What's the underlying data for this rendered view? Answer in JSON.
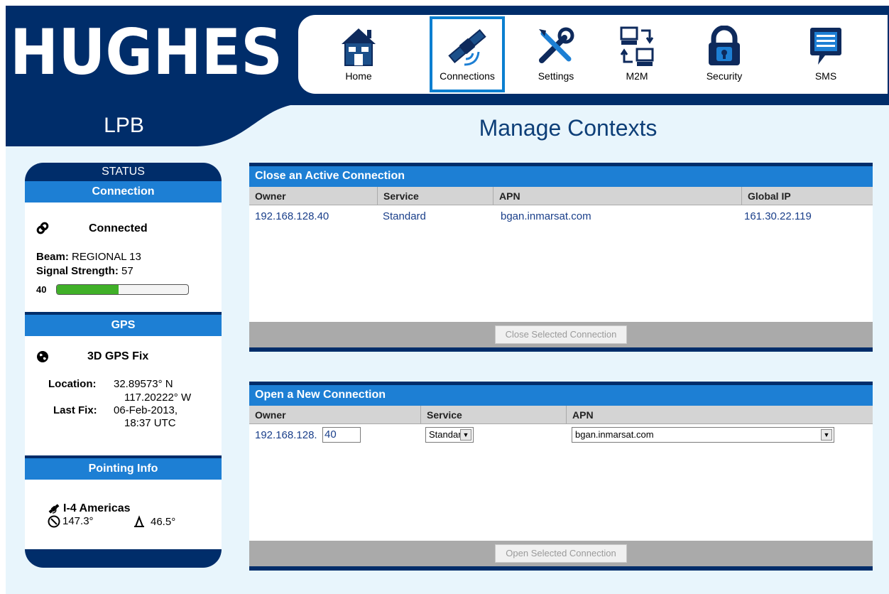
{
  "brand": {
    "logo": "HUGHES",
    "model": "LPB"
  },
  "nav": {
    "items": [
      {
        "label": "Home",
        "icon": "house-icon"
      },
      {
        "label": "Connections",
        "icon": "satellite-icon",
        "active": true
      },
      {
        "label": "Settings",
        "icon": "tools-icon"
      },
      {
        "label": "M2M",
        "icon": "computers-exchange-icon"
      },
      {
        "label": "Security",
        "icon": "padlock-icon"
      },
      {
        "label": "SMS",
        "icon": "chat-bubble-icon"
      }
    ]
  },
  "page": {
    "title": "Manage Contexts"
  },
  "sidebar": {
    "title": "STATUS",
    "connection": {
      "heading": "Connection",
      "status": "Connected",
      "beam_label": "Beam:",
      "beam_value": "REGIONAL 13",
      "signal_label": "Signal Strength:",
      "signal_value": "57",
      "threshold": "40",
      "signal_fraction": 0.47
    },
    "gps": {
      "heading": "GPS",
      "status": "3D GPS Fix",
      "location_label": "Location:",
      "lat": "32.89573° N",
      "lon": "117.20222° W",
      "lastfix_label": "Last Fix:",
      "lastfix_date": "06-Feb-2013,",
      "lastfix_time": "18:37 UTC"
    },
    "pointing": {
      "heading": "Pointing Info",
      "satellite": "I-4 Americas",
      "azimuth": "147.3°",
      "elevation": "46.5°"
    }
  },
  "close_panel": {
    "title": "Close an Active Connection",
    "columns": [
      "Owner",
      "Service",
      "APN",
      "Global IP"
    ],
    "rows": [
      {
        "owner": "192.168.128.40",
        "service": "Standard",
        "apn": "bgan.inmarsat.com",
        "global_ip": "161.30.22.119"
      }
    ],
    "button": "Close Selected Connection"
  },
  "open_panel": {
    "title": "Open a New Connection",
    "columns": [
      "Owner",
      "Service",
      "APN"
    ],
    "owner_prefix": "192.168.128.",
    "owner_suffix": "40",
    "service_selected": "Standard",
    "apn_selected": "bgan.inmarsat.com",
    "button": "Open Selected Connection"
  },
  "colors": {
    "navy": "#002d6a",
    "accent": "#1d7fd4",
    "signal": "#40b028",
    "background": "#e8f5fc"
  }
}
